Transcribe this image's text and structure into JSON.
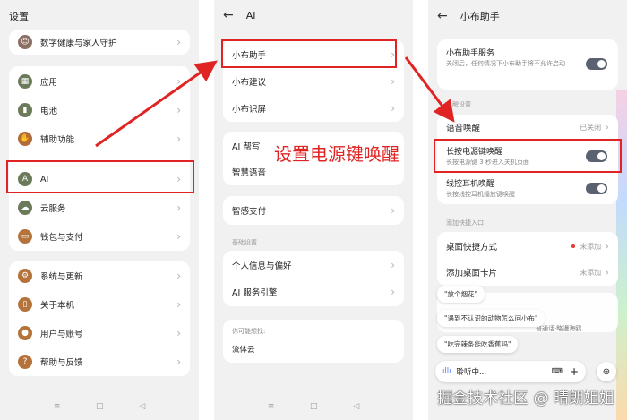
{
  "panel1": {
    "title": "设置",
    "card1": [
      {
        "label": "数字健康与家人守护",
        "icon": "child-icon"
      }
    ],
    "card2": [
      {
        "label": "应用",
        "icon": "apps-icon"
      },
      {
        "label": "电池",
        "icon": "battery-icon"
      },
      {
        "label": "辅助功能",
        "icon": "accessibility-icon"
      },
      {
        "label": "AI",
        "icon": "ai-icon"
      },
      {
        "label": "云服务",
        "icon": "cloud-icon"
      },
      {
        "label": "钱包与支付",
        "icon": "wallet-icon"
      }
    ],
    "card3": [
      {
        "label": "系统与更新",
        "icon": "gear-icon"
      },
      {
        "label": "关于本机",
        "icon": "phone-icon"
      },
      {
        "label": "用户与账号",
        "icon": "user-icon"
      },
      {
        "label": "帮助与反馈",
        "icon": "help-icon"
      }
    ]
  },
  "panel2": {
    "title": "AI",
    "card1": [
      "小布助手",
      "小布建议",
      "小布识屏"
    ],
    "card2": [
      "AI 帮写",
      "智慧语音"
    ],
    "card3": [
      "智感支付"
    ],
    "section_basic": "基础设置",
    "card4": [
      "个人信息与偏好",
      "AI 服务引擎"
    ],
    "section_search": "你可能想找:",
    "search_item": "流体云"
  },
  "panel3": {
    "title": "小布助手",
    "service_label": "小布助手服务",
    "service_desc": "关闭后，任何情况下小布助手将不允许启动",
    "section_wake": "唤醒设置",
    "voice_wake": "语音唤醒",
    "voice_wake_value": "已关闭",
    "power_wake": "长按电源键唤醒",
    "power_wake_desc": "长按电源键 3 秒进入关机页面",
    "wire_wake": "线控耳机唤醒",
    "wire_wake_desc": "长按线控耳机播放键唤醒",
    "section_shortcut": "添加快捷入口",
    "desktop_shortcut": "桌面快捷方式",
    "desktop_shortcut_value": "未添加",
    "desktop_card": "添加桌面卡片",
    "desktop_card_value": "未添加",
    "bubbles": [
      "\"放个烟花\"",
      "\"遇到不认识的动物怎么问小布\"",
      "\"吃完辣条能吃香蕉吗\""
    ],
    "bubble_tail": "普通话·略漫海鸥",
    "listening": "聆听中..."
  },
  "annotation": "设置电源键唤醒",
  "watermark": "掘金技术社区 @ 晴朗姐姐",
  "nav": [
    "≡",
    "□",
    "◁"
  ],
  "colors": {
    "highlight": "#e02424",
    "toggle": "#5a6170"
  }
}
